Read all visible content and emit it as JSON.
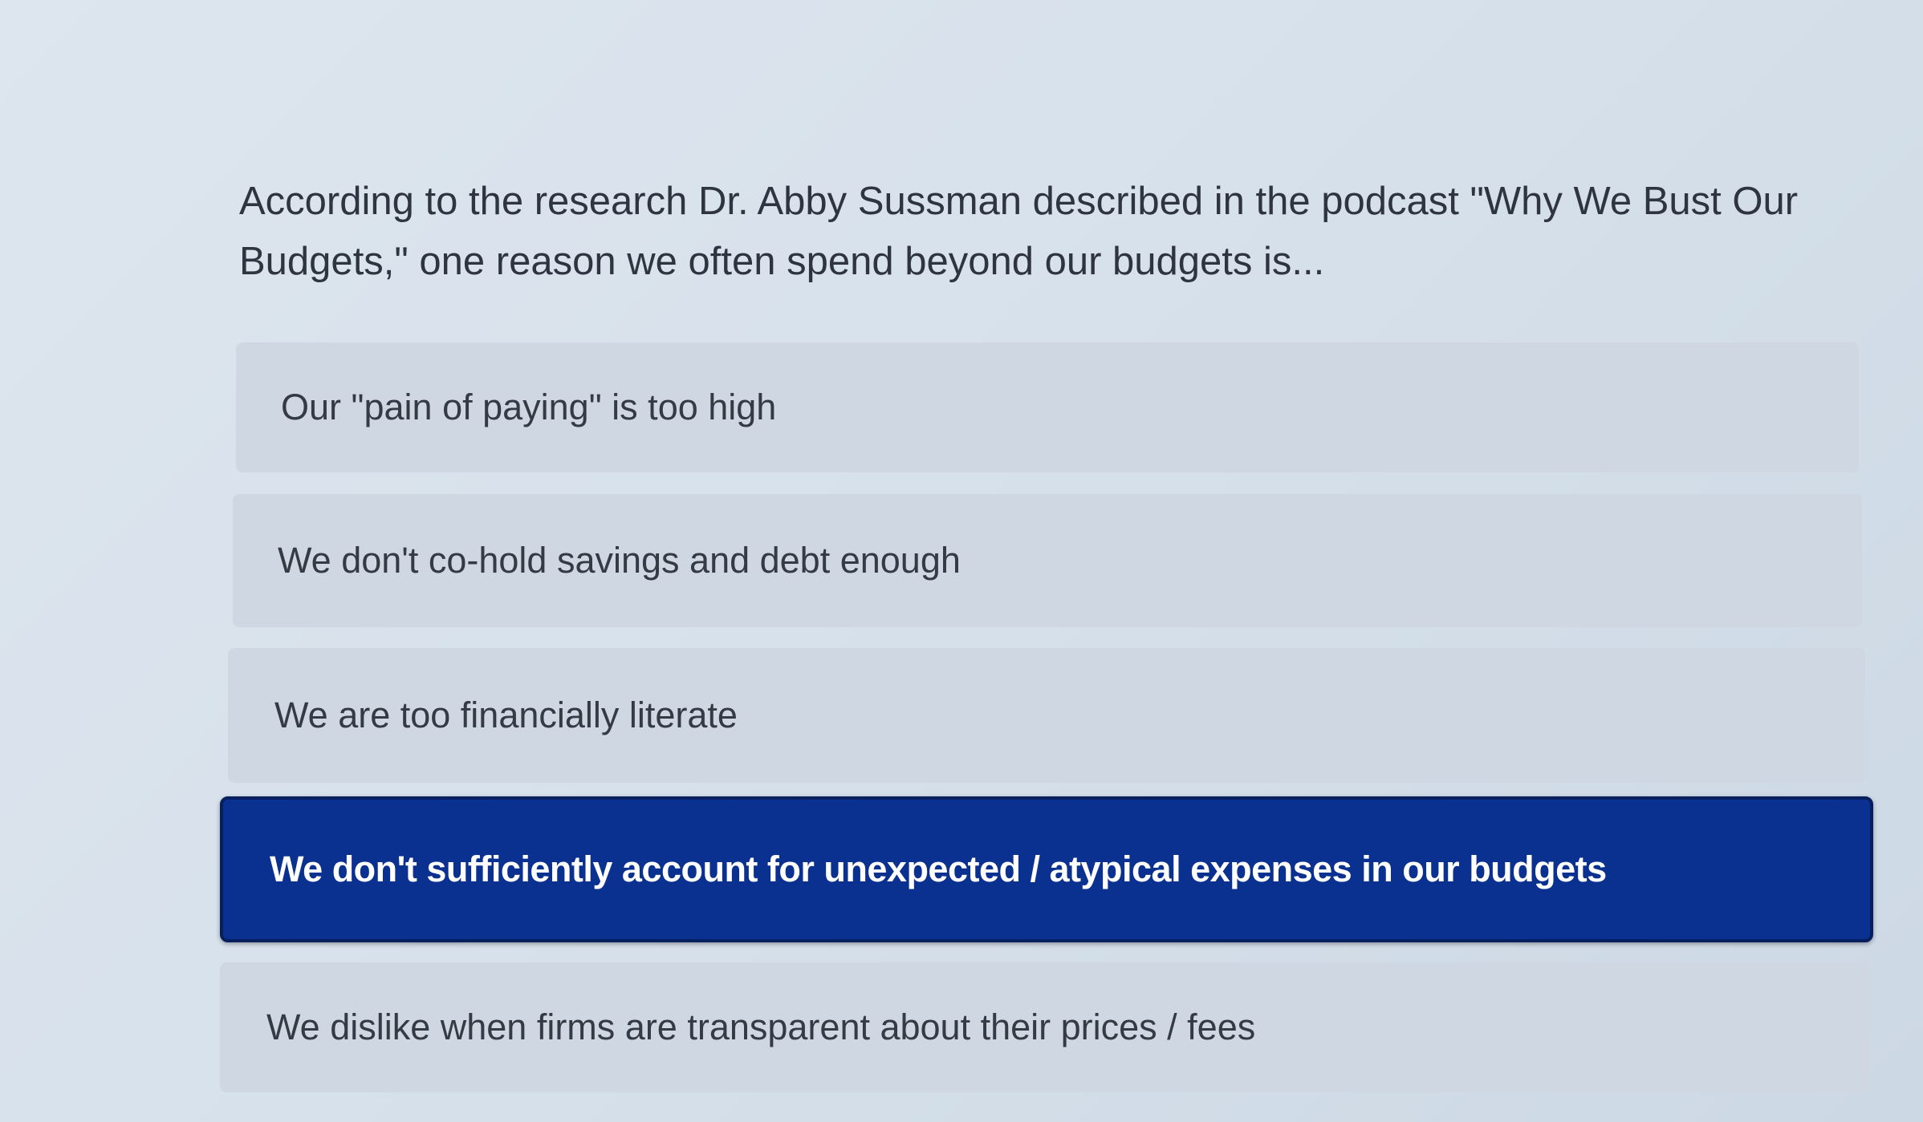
{
  "question": {
    "text": "According to the research Dr. Abby Sussman described in the podcast \"Why We Bust Our Budgets,\" one reason we often spend beyond our budgets is..."
  },
  "options": [
    {
      "label": "Our \"pain of paying\" is too high",
      "selected": false
    },
    {
      "label": "We don't co-hold savings and debt enough",
      "selected": false
    },
    {
      "label": "We are too financially literate",
      "selected": false
    },
    {
      "label": "We don't sufficiently account for unexpected / atypical expenses in our budgets",
      "selected": true
    },
    {
      "label": "We dislike when firms are transparent about their prices / fees",
      "selected": false
    }
  ],
  "colors": {
    "selected_background": "#0a3190",
    "option_background": "#cfd8e2",
    "text": "#353b45"
  }
}
